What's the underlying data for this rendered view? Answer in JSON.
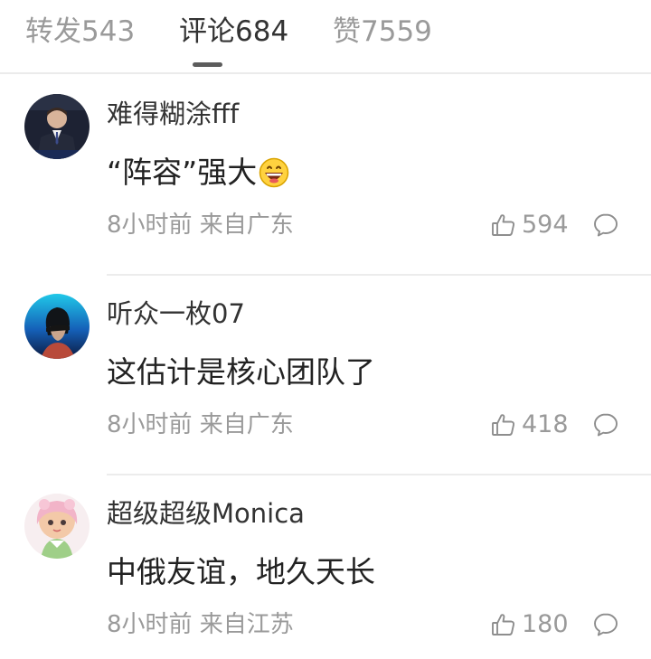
{
  "tabs": [
    {
      "label": "转发543",
      "active": false
    },
    {
      "label": "评论684",
      "active": true
    },
    {
      "label": "赞7559",
      "active": false
    }
  ],
  "comments": [
    {
      "username": "难得糊涂fff",
      "text": "“阵容”强大",
      "emoji": "grinning-emoji",
      "meta": "8小时前 来自广东",
      "likes": "594"
    },
    {
      "username": "听众一枚07",
      "text": "这估计是核心团队了",
      "meta": "8小时前 来自广东",
      "likes": "418"
    },
    {
      "username": "超级超级Monica",
      "text": "中俄友谊，地久天长",
      "meta": "8小时前 来自江苏",
      "likes": "180"
    }
  ],
  "colors": {
    "text_primary": "#333333",
    "text_secondary": "#9a9a9a",
    "divider": "#ececec",
    "tab_indicator": "#5c5c5c"
  }
}
